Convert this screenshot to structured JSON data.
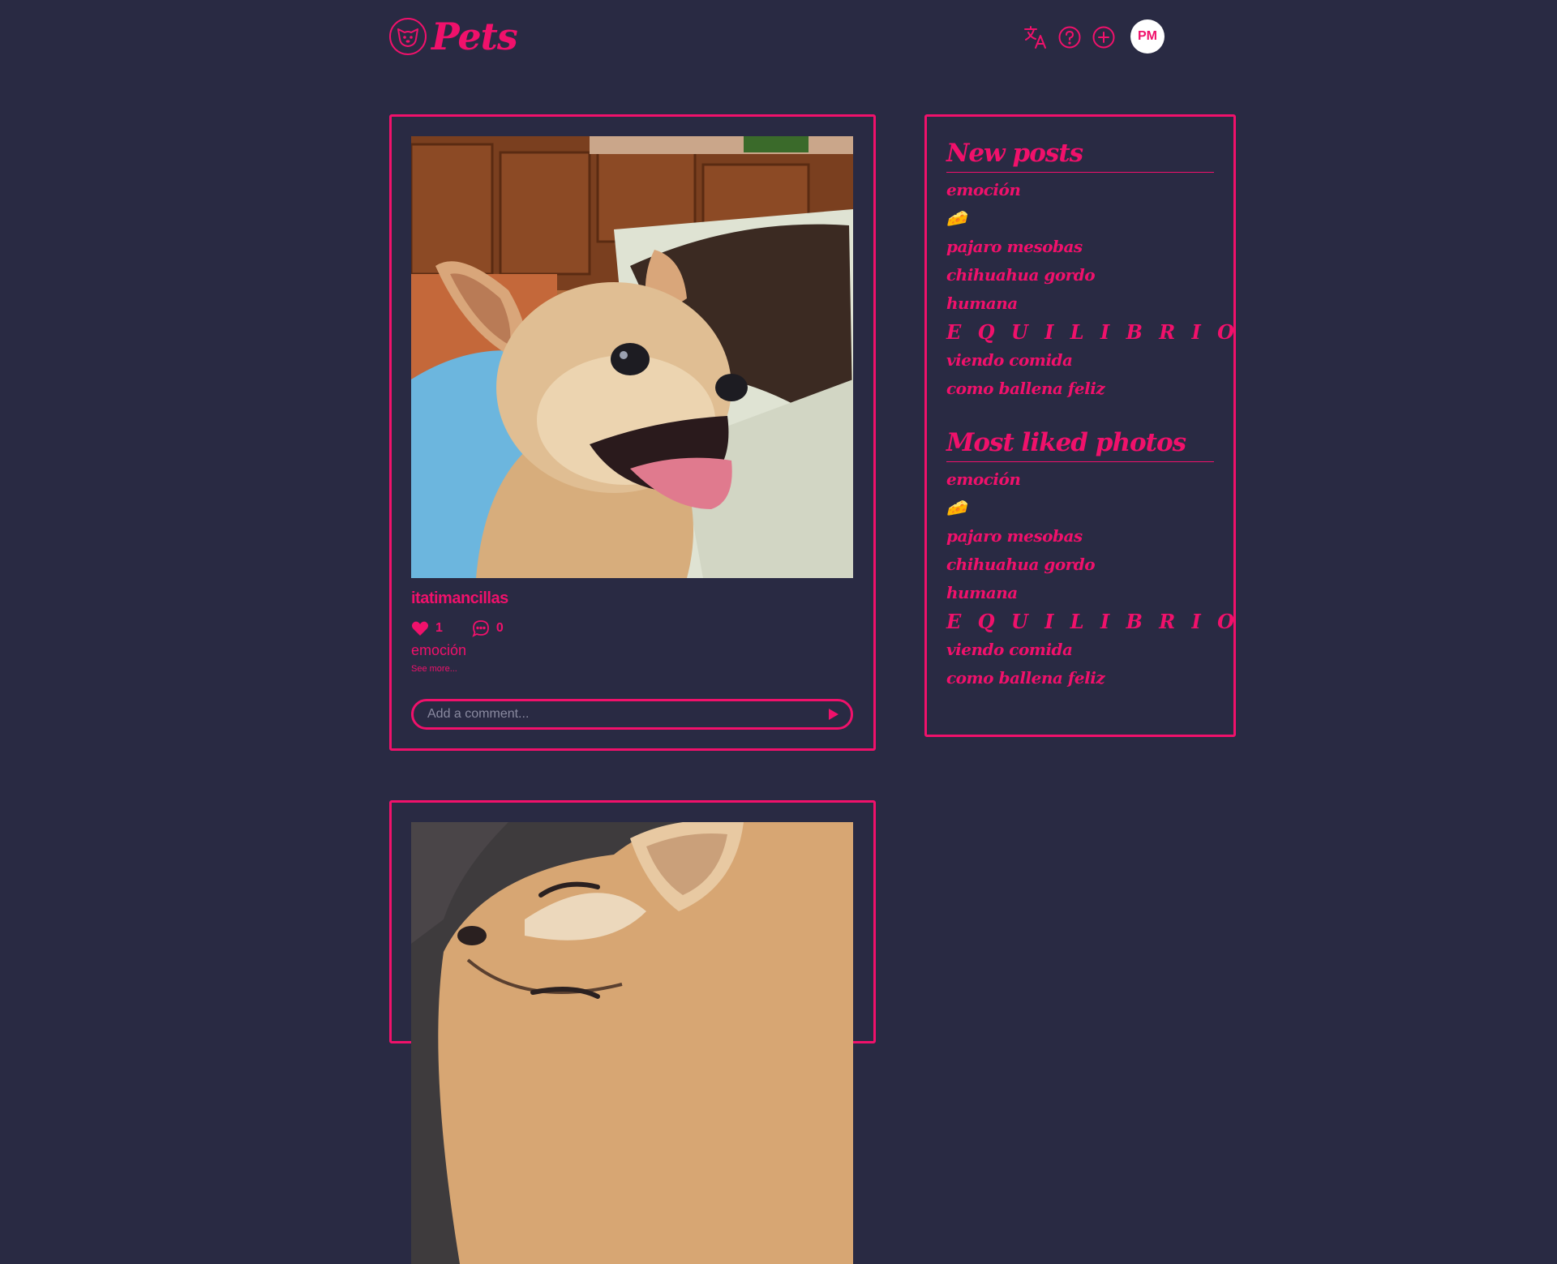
{
  "header": {
    "logo_text": "Pets",
    "avatar_initials": "PM",
    "icons": [
      "translate-icon",
      "help-icon",
      "add-post-icon"
    ]
  },
  "posts": [
    {
      "author": "itatimancillas",
      "likes": "1",
      "comments": "0",
      "caption": "emoción",
      "see_more": "See more...",
      "comment_placeholder": "Add a comment..."
    },
    {
      "author": "",
      "likes": "",
      "comments": "",
      "caption": ""
    }
  ],
  "sidebar": {
    "new_posts": {
      "title": "New posts",
      "items": [
        "emoción",
        "🧀",
        "pajaro mesobas",
        "chihuahua gordo",
        "humana",
        "E Q U I L I B R I O",
        "viendo comida",
        "como ballena feliz"
      ]
    },
    "most_liked": {
      "title": "Most liked photos",
      "items": [
        "emoción",
        "🧀",
        "pajaro mesobas",
        "chihuahua gordo",
        "humana",
        "E Q U I L I B R I O",
        "viendo comida",
        "como ballena feliz"
      ]
    }
  },
  "colors": {
    "background": "#292a43",
    "accent": "#f0116b",
    "avatar_bg": "#ffffff"
  }
}
